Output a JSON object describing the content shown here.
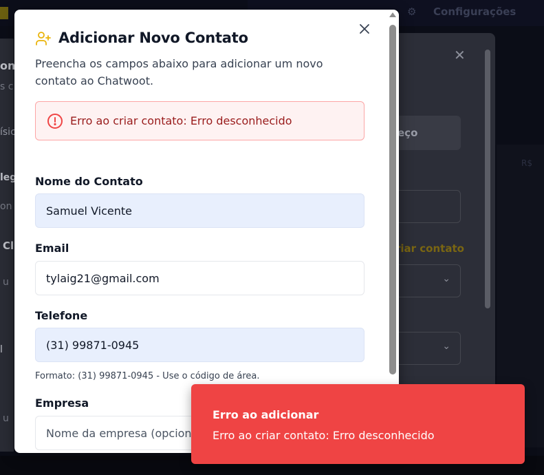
{
  "background": {
    "top_label": "Configurações",
    "tab_label": "eço",
    "link_label": "riar contato",
    "left_fragments": [
      "on",
      "s c",
      "ísic",
      "leg",
      "on",
      "Cl",
      "u",
      "l",
      "u"
    ],
    "right_fragment": "R$"
  },
  "modal": {
    "icon": "user-plus-icon",
    "title": "Adicionar Novo Contato",
    "description": "Preencha os campos abaixo para adicionar um novo contato ao Chatwoot.",
    "alert": {
      "icon": "alert-circle-icon",
      "text": "Erro ao criar contato: Erro desconhecido"
    },
    "fields": {
      "name": {
        "label": "Nome do Contato",
        "value": "Samuel Vicente"
      },
      "email": {
        "label": "Email",
        "value": "tylaig21@gmail.com"
      },
      "phone": {
        "label": "Telefone",
        "value": "(31) 99871-0945",
        "hint": "Formato: (31) 99871-0945 - Use o código de área."
      },
      "company": {
        "label": "Empresa",
        "placeholder": "Nome da empresa (opcional)"
      }
    }
  },
  "toast": {
    "title": "Erro ao adicionar",
    "message": "Erro ao criar contato: Erro desconhecido"
  },
  "colors": {
    "accent": "#facc15",
    "error": "#ef4444",
    "alert_bg": "#fef2f2",
    "alert_text": "#991b1b",
    "autofill": "#e8effd"
  }
}
